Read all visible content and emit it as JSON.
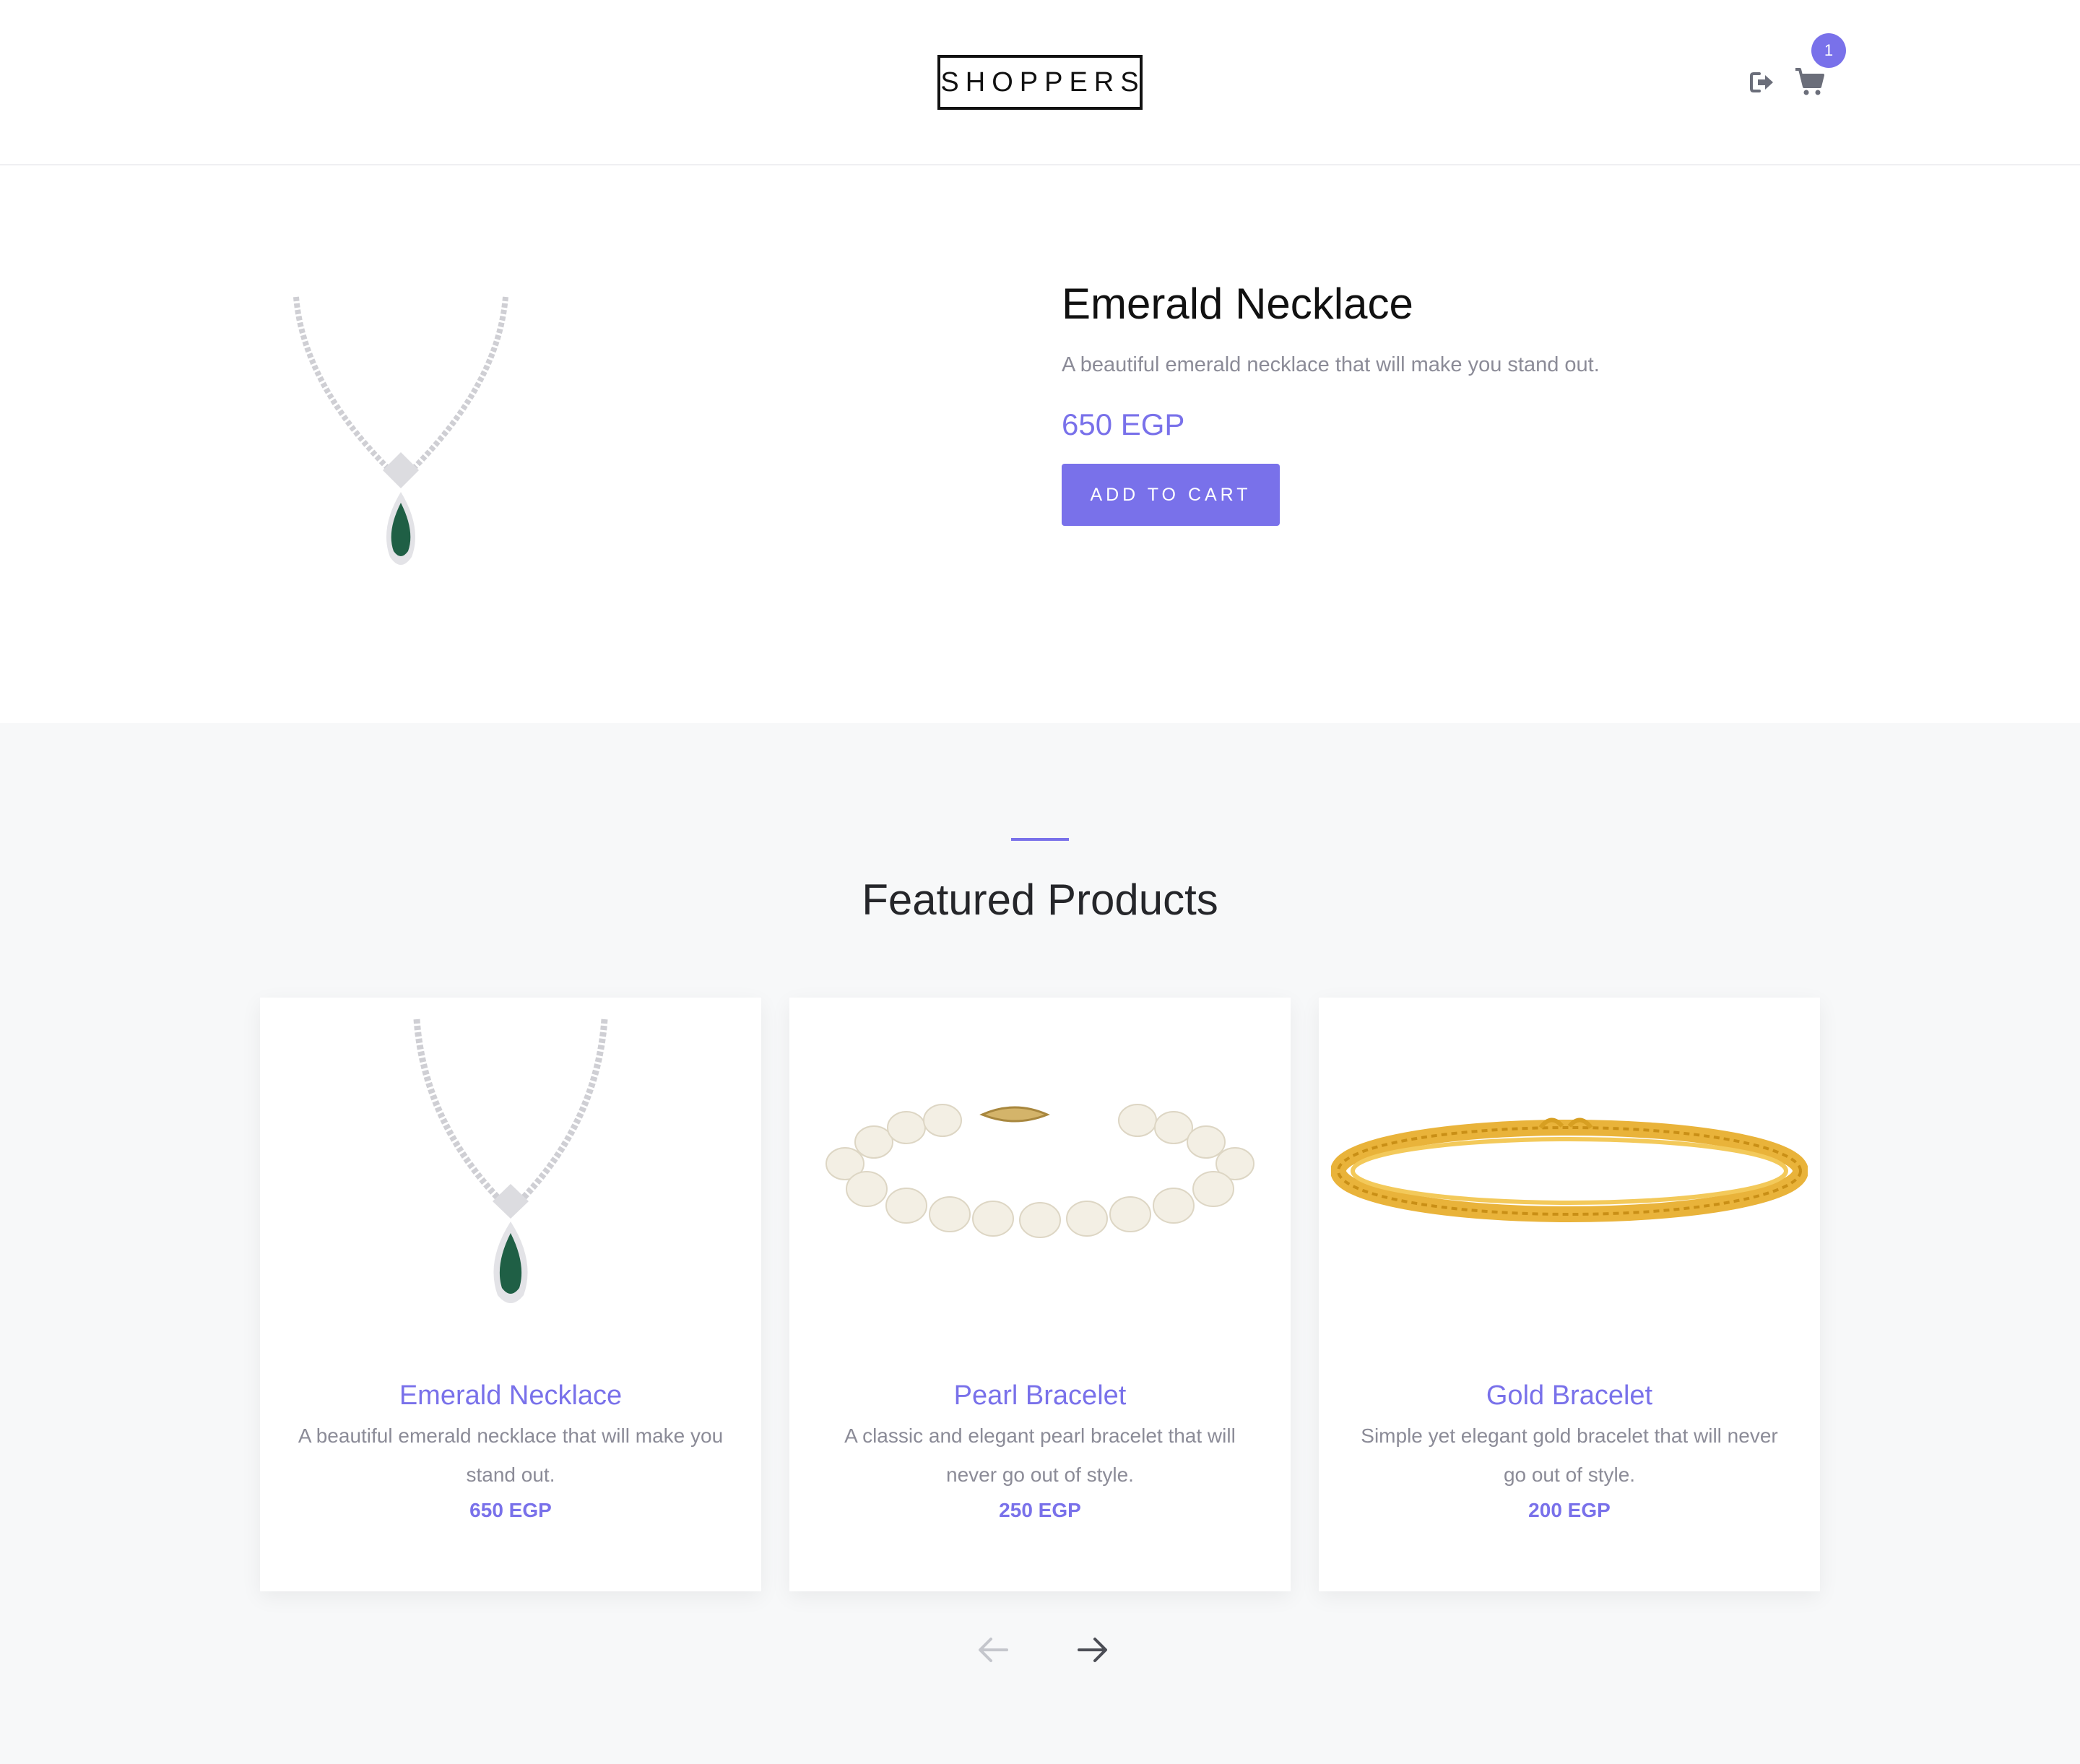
{
  "header": {
    "logo": "SHOPPERS",
    "cart_count": "1",
    "logout_icon": "sign-out-icon",
    "cart_icon": "shopping-cart-icon"
  },
  "product": {
    "title": "Emerald Necklace",
    "description": "A beautiful emerald necklace that will make you stand out.",
    "price": "650 EGP",
    "add_to_cart_label": "ADD TO CART"
  },
  "featured": {
    "title": "Featured Products",
    "items": [
      {
        "name": "Emerald Necklace",
        "description": "A beautiful emerald necklace that will make you stand out.",
        "price": "650 EGP",
        "image": "emerald-necklace"
      },
      {
        "name": "Pearl Bracelet",
        "description": "A classic and elegant pearl bracelet that will never go out of style.",
        "price": "250 EGP",
        "image": "pearl-bracelet"
      },
      {
        "name": "Gold Bracelet",
        "description": "Simple yet elegant gold bracelet that will never go out of style.",
        "price": "200 EGP",
        "image": "gold-bracelet"
      }
    ],
    "prev_icon": "arrow-left-icon",
    "next_icon": "arrow-right-icon"
  },
  "colors": {
    "accent": "#7971ea",
    "muted_text": "#8b8b97",
    "section_bg": "#f7f8f9"
  }
}
